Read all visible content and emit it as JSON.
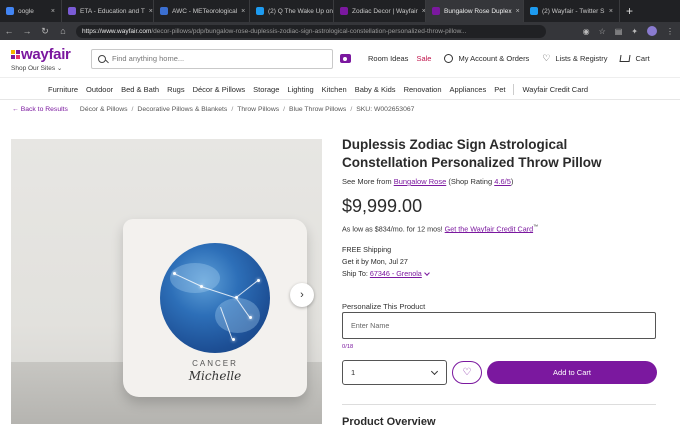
{
  "browser": {
    "tabs": [
      {
        "title": "oogle",
        "color": "#4285f4"
      },
      {
        "title": "ETA - Education and T",
        "color": "#7a5bd6"
      },
      {
        "title": "AWC - METeorological",
        "color": "#3b6fd1"
      },
      {
        "title": "(2) Q The Wake Up on",
        "color": "#1d9bf0"
      },
      {
        "title": "Zodiac Decor | Wayfair",
        "color": "#7b189f"
      },
      {
        "title": "Bungalow Rose Duplex",
        "color": "#7b189f"
      },
      {
        "title": "(2) Wayfair - Twitter S",
        "color": "#1d9bf0"
      }
    ],
    "active_tab": 5,
    "url_host": "https://www.wayfair.com",
    "url_path": "/decor-pillows/pdp/bungalow-rose-duplessis-zodiac-sign-astrological-constellation-personalized-throw-pillow..."
  },
  "header": {
    "logo_text": "wayfair",
    "shop_sites": "Shop Our Sites",
    "search_placeholder": "Find anything home...",
    "room_ideas": "Room Ideas",
    "sale": "Sale",
    "account": "My Account & Orders",
    "lists": "Lists & Registry",
    "cart": "Cart"
  },
  "categories": [
    "Furniture",
    "Outdoor",
    "Bed & Bath",
    "Rugs",
    "Décor & Pillows",
    "Storage",
    "Lighting",
    "Kitchen",
    "Baby & Kids",
    "Renovation",
    "Appliances",
    "Pet"
  ],
  "credit_card_link": "Wayfair Credit Card",
  "breadcrumb": {
    "back": "Back to Results",
    "items": [
      "Décor & Pillows",
      "Decorative Pillows & Blankets",
      "Throw Pillows",
      "Blue Throw Pillows"
    ],
    "sku": "SKU: W002653067"
  },
  "product": {
    "title": "Duplessis Zodiac Sign Astrological Constellation Personalized Throw Pillow",
    "see_more_prefix": "See More from",
    "brand": "Bungalow Rose",
    "rating_prefix": "(Shop Rating",
    "rating": "4.6/5",
    "rating_suffix": ")",
    "price": "$9,999.00",
    "financing_text": "As low as $834/mo. for 12 mos!",
    "financing_link": "Get the Wayfair Credit Card",
    "shipping": "FREE Shipping",
    "delivery": "Get it by Mon, Jul 27",
    "ship_to_label": "Ship To:",
    "ship_to_value": "67346 - Grenola",
    "personalize_label": "Personalize This Product",
    "name_placeholder": "Enter Name",
    "char_count": "0/18",
    "quantity": "1",
    "add_to_cart": "Add to Cart",
    "overview_heading": "Product Overview",
    "image_sign": "CANCER",
    "image_name": "Michelle"
  },
  "colors": {
    "brand": "#7b189f",
    "sale": "#c0134b"
  }
}
